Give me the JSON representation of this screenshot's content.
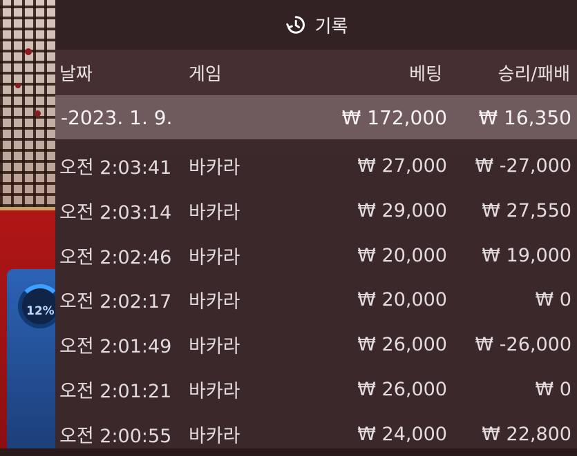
{
  "panel": {
    "title": "기록",
    "icon": "history-icon"
  },
  "columns": {
    "date": "날짜",
    "game": "게임",
    "bet": "베팅",
    "result": "승리/패배"
  },
  "summary": {
    "date": "-2023. 1. 9.",
    "bet": "₩ 172,000",
    "result": "₩ 16,350"
  },
  "rows": [
    {
      "time": "오전 2:03:41",
      "game": "바카라",
      "bet": "₩ 27,000",
      "result": "₩ -27,000"
    },
    {
      "time": "오전 2:03:14",
      "game": "바카라",
      "bet": "₩ 29,000",
      "result": "₩ 27,550"
    },
    {
      "time": "오전 2:02:46",
      "game": "바카라",
      "bet": "₩ 20,000",
      "result": "₩ 19,000"
    },
    {
      "time": "오전 2:02:17",
      "game": "바카라",
      "bet": "₩ 20,000",
      "result": "₩ 0"
    },
    {
      "time": "오전 2:01:49",
      "game": "바카라",
      "bet": "₩ 26,000",
      "result": "₩ -26,000"
    },
    {
      "time": "오전 2:01:21",
      "game": "바카라",
      "bet": "₩ 26,000",
      "result": "₩ 0"
    },
    {
      "time": "오전 2:00:55",
      "game": "바카라",
      "bet": "₩ 24,000",
      "result": "₩ 22,800"
    }
  ],
  "background": {
    "timer_percent": "12%"
  }
}
